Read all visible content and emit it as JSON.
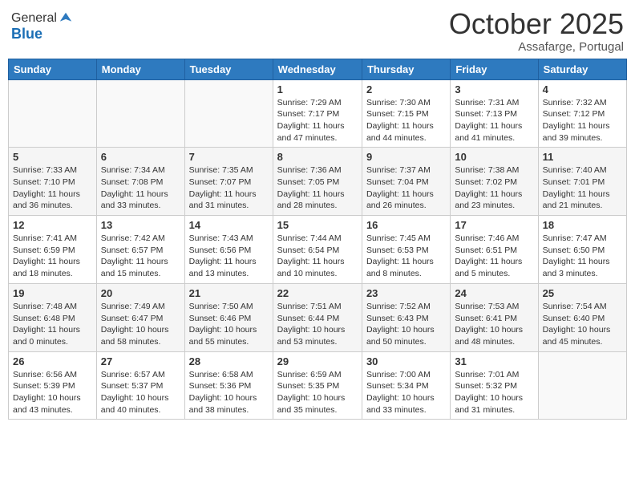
{
  "header": {
    "logo_general": "General",
    "logo_blue": "Blue",
    "month_title": "October 2025",
    "subtitle": "Assafarge, Portugal"
  },
  "days_of_week": [
    "Sunday",
    "Monday",
    "Tuesday",
    "Wednesday",
    "Thursday",
    "Friday",
    "Saturday"
  ],
  "weeks": [
    [
      {
        "day": "",
        "empty": true
      },
      {
        "day": "",
        "empty": true
      },
      {
        "day": "",
        "empty": true
      },
      {
        "day": "1",
        "sunrise": "7:29 AM",
        "sunset": "7:17 PM",
        "daylight": "11 hours and 47 minutes."
      },
      {
        "day": "2",
        "sunrise": "7:30 AM",
        "sunset": "7:15 PM",
        "daylight": "11 hours and 44 minutes."
      },
      {
        "day": "3",
        "sunrise": "7:31 AM",
        "sunset": "7:13 PM",
        "daylight": "11 hours and 41 minutes."
      },
      {
        "day": "4",
        "sunrise": "7:32 AM",
        "sunset": "7:12 PM",
        "daylight": "11 hours and 39 minutes."
      }
    ],
    [
      {
        "day": "5",
        "sunrise": "7:33 AM",
        "sunset": "7:10 PM",
        "daylight": "11 hours and 36 minutes."
      },
      {
        "day": "6",
        "sunrise": "7:34 AM",
        "sunset": "7:08 PM",
        "daylight": "11 hours and 33 minutes."
      },
      {
        "day": "7",
        "sunrise": "7:35 AM",
        "sunset": "7:07 PM",
        "daylight": "11 hours and 31 minutes."
      },
      {
        "day": "8",
        "sunrise": "7:36 AM",
        "sunset": "7:05 PM",
        "daylight": "11 hours and 28 minutes."
      },
      {
        "day": "9",
        "sunrise": "7:37 AM",
        "sunset": "7:04 PM",
        "daylight": "11 hours and 26 minutes."
      },
      {
        "day": "10",
        "sunrise": "7:38 AM",
        "sunset": "7:02 PM",
        "daylight": "11 hours and 23 minutes."
      },
      {
        "day": "11",
        "sunrise": "7:40 AM",
        "sunset": "7:01 PM",
        "daylight": "11 hours and 21 minutes."
      }
    ],
    [
      {
        "day": "12",
        "sunrise": "7:41 AM",
        "sunset": "6:59 PM",
        "daylight": "11 hours and 18 minutes."
      },
      {
        "day": "13",
        "sunrise": "7:42 AM",
        "sunset": "6:57 PM",
        "daylight": "11 hours and 15 minutes."
      },
      {
        "day": "14",
        "sunrise": "7:43 AM",
        "sunset": "6:56 PM",
        "daylight": "11 hours and 13 minutes."
      },
      {
        "day": "15",
        "sunrise": "7:44 AM",
        "sunset": "6:54 PM",
        "daylight": "11 hours and 10 minutes."
      },
      {
        "day": "16",
        "sunrise": "7:45 AM",
        "sunset": "6:53 PM",
        "daylight": "11 hours and 8 minutes."
      },
      {
        "day": "17",
        "sunrise": "7:46 AM",
        "sunset": "6:51 PM",
        "daylight": "11 hours and 5 minutes."
      },
      {
        "day": "18",
        "sunrise": "7:47 AM",
        "sunset": "6:50 PM",
        "daylight": "11 hours and 3 minutes."
      }
    ],
    [
      {
        "day": "19",
        "sunrise": "7:48 AM",
        "sunset": "6:48 PM",
        "daylight": "11 hours and 0 minutes."
      },
      {
        "day": "20",
        "sunrise": "7:49 AM",
        "sunset": "6:47 PM",
        "daylight": "10 hours and 58 minutes."
      },
      {
        "day": "21",
        "sunrise": "7:50 AM",
        "sunset": "6:46 PM",
        "daylight": "10 hours and 55 minutes."
      },
      {
        "day": "22",
        "sunrise": "7:51 AM",
        "sunset": "6:44 PM",
        "daylight": "10 hours and 53 minutes."
      },
      {
        "day": "23",
        "sunrise": "7:52 AM",
        "sunset": "6:43 PM",
        "daylight": "10 hours and 50 minutes."
      },
      {
        "day": "24",
        "sunrise": "7:53 AM",
        "sunset": "6:41 PM",
        "daylight": "10 hours and 48 minutes."
      },
      {
        "day": "25",
        "sunrise": "7:54 AM",
        "sunset": "6:40 PM",
        "daylight": "10 hours and 45 minutes."
      }
    ],
    [
      {
        "day": "26",
        "sunrise": "6:56 AM",
        "sunset": "5:39 PM",
        "daylight": "10 hours and 43 minutes."
      },
      {
        "day": "27",
        "sunrise": "6:57 AM",
        "sunset": "5:37 PM",
        "daylight": "10 hours and 40 minutes."
      },
      {
        "day": "28",
        "sunrise": "6:58 AM",
        "sunset": "5:36 PM",
        "daylight": "10 hours and 38 minutes."
      },
      {
        "day": "29",
        "sunrise": "6:59 AM",
        "sunset": "5:35 PM",
        "daylight": "10 hours and 35 minutes."
      },
      {
        "day": "30",
        "sunrise": "7:00 AM",
        "sunset": "5:34 PM",
        "daylight": "10 hours and 33 minutes."
      },
      {
        "day": "31",
        "sunrise": "7:01 AM",
        "sunset": "5:32 PM",
        "daylight": "10 hours and 31 minutes."
      },
      {
        "day": "",
        "empty": true
      }
    ]
  ]
}
